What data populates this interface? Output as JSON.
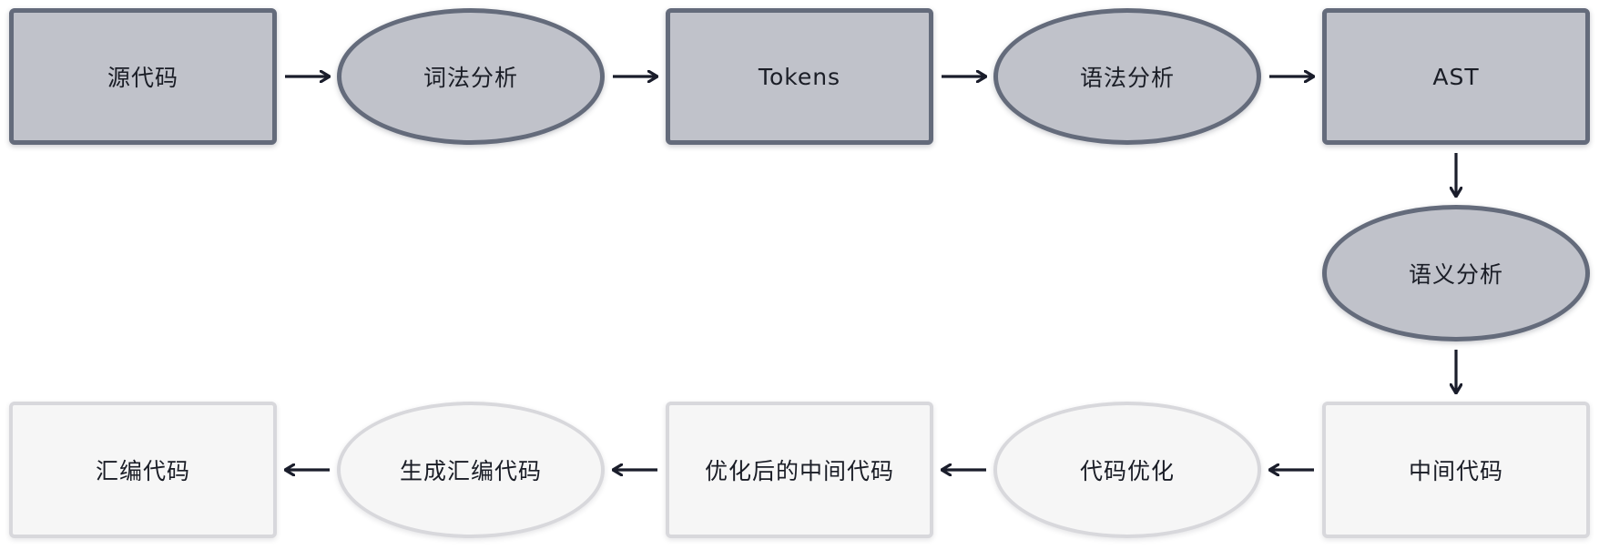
{
  "diagram": {
    "nodes": [
      {
        "id": "source-code",
        "label": "源代码",
        "shape": "rect",
        "style": "dark"
      },
      {
        "id": "lexical-analysis",
        "label": "词法分析",
        "shape": "ellipse",
        "style": "dark"
      },
      {
        "id": "tokens",
        "label": "Tokens",
        "shape": "rect",
        "style": "dark"
      },
      {
        "id": "syntax-analysis",
        "label": "语法分析",
        "shape": "ellipse",
        "style": "dark"
      },
      {
        "id": "ast",
        "label": "AST",
        "shape": "rect",
        "style": "dark"
      },
      {
        "id": "semantic-analysis",
        "label": "语义分析",
        "shape": "ellipse",
        "style": "dark"
      },
      {
        "id": "intermediate-code",
        "label": "中间代码",
        "shape": "rect",
        "style": "light"
      },
      {
        "id": "code-optimization",
        "label": "代码优化",
        "shape": "ellipse",
        "style": "light"
      },
      {
        "id": "optimized-intermediate-code",
        "label": "优化后的中间代码",
        "shape": "rect",
        "style": "light"
      },
      {
        "id": "generate-assembly",
        "label": "生成汇编代码",
        "shape": "ellipse",
        "style": "light"
      },
      {
        "id": "assembly-code",
        "label": "汇编代码",
        "shape": "rect",
        "style": "light"
      }
    ],
    "edges": [
      {
        "from": "source-code",
        "to": "lexical-analysis"
      },
      {
        "from": "lexical-analysis",
        "to": "tokens"
      },
      {
        "from": "tokens",
        "to": "syntax-analysis"
      },
      {
        "from": "syntax-analysis",
        "to": "ast"
      },
      {
        "from": "ast",
        "to": "semantic-analysis"
      },
      {
        "from": "semantic-analysis",
        "to": "intermediate-code"
      },
      {
        "from": "intermediate-code",
        "to": "code-optimization"
      },
      {
        "from": "code-optimization",
        "to": "optimized-intermediate-code"
      },
      {
        "from": "optimized-intermediate-code",
        "to": "generate-assembly"
      },
      {
        "from": "generate-assembly",
        "to": "assembly-code"
      }
    ],
    "colors": {
      "dark_fill": "#c0c2ca",
      "dark_border": "#646b7b",
      "light_fill": "#f6f6f6",
      "light_border": "#d8d8dc",
      "arrow": "#1a1d2b"
    }
  }
}
